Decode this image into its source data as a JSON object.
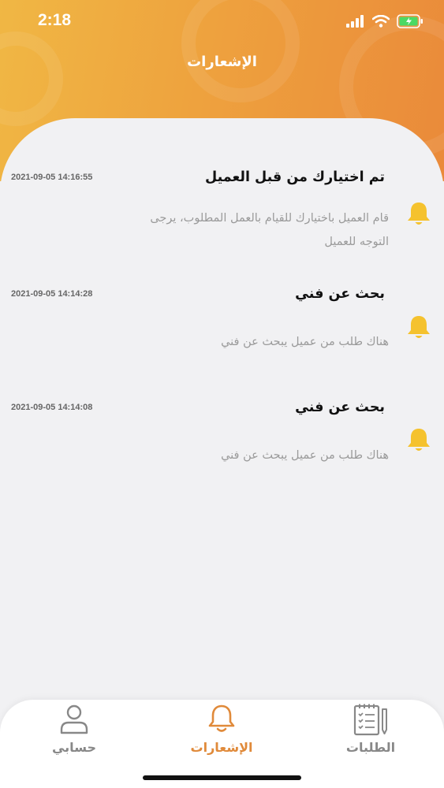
{
  "status_bar": {
    "time": "2:18"
  },
  "header": {
    "title": "الإشعارات"
  },
  "notifications": [
    {
      "title": "تم اختيارك من قبل العميل",
      "timestamp": "2021-09-05 14:16:55",
      "body_line1": "قام العميل باختيارك للقيام بالعمل المطلوب، يرجى",
      "body_line2": "التوجه للعميل",
      "icon": "bell-icon"
    },
    {
      "title": "بحث عن فني",
      "timestamp": "2021-09-05 14:14:28",
      "body_line1": "هناك طلب من عميل يبحث عن فني",
      "icon": "bell-icon"
    },
    {
      "title": "بحث عن فني",
      "timestamp": "2021-09-05 14:14:08",
      "body_line1": "هناك طلب من عميل يبحث عن فني",
      "icon": "bell-icon"
    }
  ],
  "tabbar": {
    "tabs": [
      {
        "label": "حسابي",
        "icon": "person-icon",
        "active": false
      },
      {
        "label": "الإشعارات",
        "icon": "bell-icon",
        "active": true
      },
      {
        "label": "الطلبات",
        "icon": "clipboard-icon",
        "active": false
      }
    ]
  },
  "colors": {
    "accent": "#e08a3a",
    "bell": "#f5c22e",
    "header_start": "#f0b744",
    "header_end": "#ea8a3a"
  }
}
